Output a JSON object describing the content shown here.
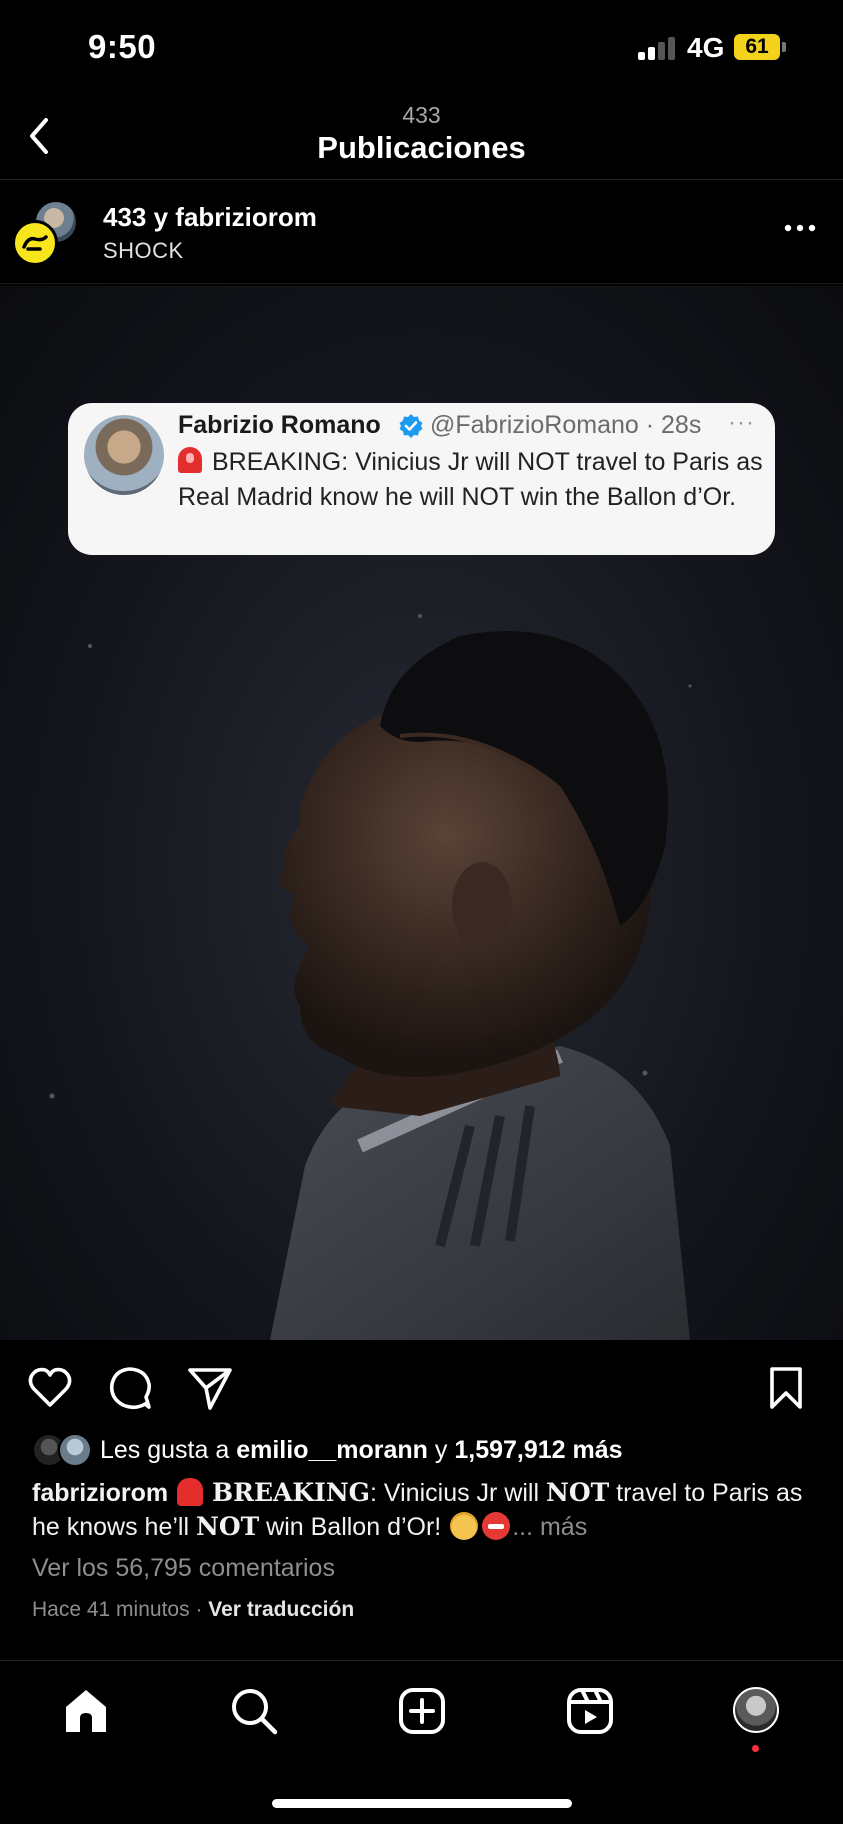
{
  "status_bar": {
    "time": "9:50",
    "network": "4G",
    "battery": "61",
    "battery_color": "#f3d21c"
  },
  "header": {
    "account": "433",
    "title": "Publicaciones"
  },
  "post": {
    "author": "433 y fabriziorom",
    "location": "SHOCK",
    "tweet": {
      "name": "Fabrizio Romano",
      "handle": "@FabrizioRomano · 28s",
      "dots": "···",
      "text": "BREAKING: Vinicius Jr will NOT travel to Paris as Real Madrid know he will NOT win the Ballon d’Or."
    },
    "likes": {
      "prefix": "Les gusta a",
      "user": "emilio__morann",
      "joiner": "y",
      "count": "1,597,912 más"
    },
    "caption": {
      "user": "fabriziorom",
      "breaking": "BREAKING",
      "part1": ": Vinicius Jr will ",
      "not1": "NOT",
      "part2": " travel to Paris as he knows he’ll ",
      "not2": "NOT",
      "part3": " win Ballon d’Or! ",
      "more": "... más"
    },
    "comments_link": "Ver los 56,795 comentarios",
    "time_ago": "Hace 41 minutos",
    "separator": "·",
    "translate": "Ver traducción"
  },
  "icons": {
    "back": "chevron-left-icon",
    "more": "more-horizontal-icon",
    "like": "heart-icon",
    "comment": "comment-icon",
    "share": "send-icon",
    "save": "bookmark-icon",
    "home": "home-icon",
    "search": "search-icon",
    "create": "plus-square-icon",
    "reels": "reels-icon",
    "verified": "verified-badge-icon"
  },
  "colors": {
    "background": "#000000",
    "verified": "#1d9bf0",
    "notification_dot": "#ff3040"
  }
}
